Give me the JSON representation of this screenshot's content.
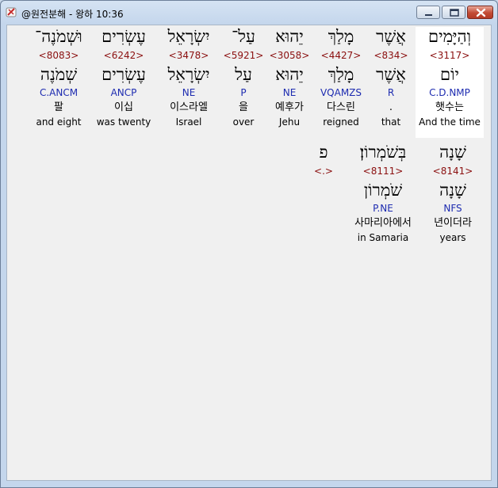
{
  "window": {
    "title": "@원전분해 - 왕하 10:36",
    "controls": {
      "minimize": "minimize",
      "maximize": "maximize",
      "close": "close"
    }
  },
  "row1": [
    {
      "hebrew": "וְהַיָּמִים",
      "strong": "<3117>",
      "lemma": "יוֹם",
      "morph": "C.D.NMP",
      "korean": "햇수는",
      "english": "And the time",
      "highlighted": true
    },
    {
      "hebrew": "אֲשֶׁר",
      "strong": "<834>",
      "lemma": "אֲשֶׁר",
      "morph": "R",
      "korean": ".",
      "english": "that"
    },
    {
      "hebrew": "מָלַךְ",
      "strong": "<4427>",
      "lemma": "מָלַךְ",
      "morph": "VQAMZS",
      "korean": "다스린",
      "english": "reigned"
    },
    {
      "hebrew": "יֵהוּא",
      "strong": "<3058>",
      "lemma": "יֵהוּא",
      "morph": "NE",
      "korean": "예후가",
      "english": "Jehu"
    },
    {
      "hebrew": "עַל־",
      "strong": "<5921>",
      "lemma": "עַל",
      "morph": "P",
      "korean": "을",
      "english": "over"
    },
    {
      "hebrew": "יִשְׂרָאֵל",
      "strong": "<3478>",
      "lemma": "יִשְׂרָאֵל",
      "morph": "NE",
      "korean": "이스라엘",
      "english": "Israel"
    },
    {
      "hebrew": "עֶשְׂרִים",
      "strong": "<6242>",
      "lemma": "עֶשְׂרִים",
      "morph": "ANCP",
      "korean": "이십",
      "english": "was twenty"
    },
    {
      "hebrew": "וּשְׁמֹנֶה־",
      "strong": "<8083>",
      "lemma": "שְׁמֹנֶה",
      "morph": "C.ANCM",
      "korean": "팔",
      "english": "and eight"
    }
  ],
  "row2": [
    {
      "hebrew": "שָׁנָה",
      "strong": "<8141>",
      "lemma": "שָׁנָה",
      "morph": "NFS",
      "korean": "년이더라",
      "english": "years"
    },
    {
      "hebrew": "בְּשֹׁמְרוֹן׃",
      "strong": "<8111>",
      "lemma": "שֹׁמְרוֹן",
      "morph": "P.NE",
      "korean": "사마리아에서",
      "english": "in Samaria"
    },
    {
      "hebrew": "פ",
      "strong": "<.>",
      "lemma": "",
      "morph": "",
      "korean": "",
      "english": ""
    }
  ]
}
